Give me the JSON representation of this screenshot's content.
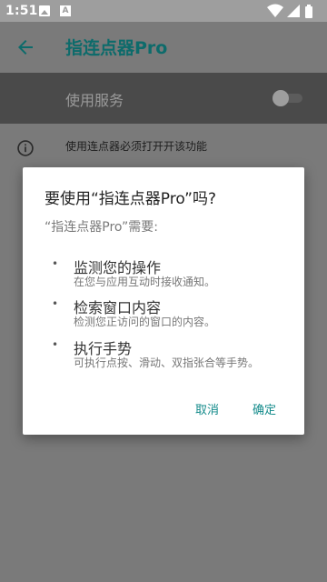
{
  "status_bar": {
    "time": "1:51",
    "notification_icons": [
      "image-icon",
      "font-a-icon"
    ],
    "right_icons": [
      "wifi-icon",
      "cellular-signal-icon",
      "battery-icon"
    ]
  },
  "app_bar": {
    "title": "指连点器Pro",
    "back_icon": "arrow-back-icon"
  },
  "service": {
    "label": "使用服务",
    "enabled": false
  },
  "info": {
    "icon": "info-icon",
    "text": "使用连点器必须打开开该功能"
  },
  "dialog": {
    "title": "要使用“指连点器Pro”吗?",
    "subtitle": "“指连点器Pro”需要:",
    "bullet": "•",
    "permissions": [
      {
        "title": "监测您的操作",
        "desc": "在您与应用互动时接收通知。"
      },
      {
        "title": "检索窗口内容",
        "desc": "检测您正访问的窗口的内容。"
      },
      {
        "title": "执行手势",
        "desc": "可执行点按、滑动、双指张合等手势。"
      }
    ],
    "cancel_label": "取消",
    "ok_label": "确定"
  },
  "colors": {
    "accent": "#128a8a",
    "status_bar": "#9e9e9e",
    "dim_background": "#7a7a7a",
    "section_background": "#4a4a4a"
  }
}
